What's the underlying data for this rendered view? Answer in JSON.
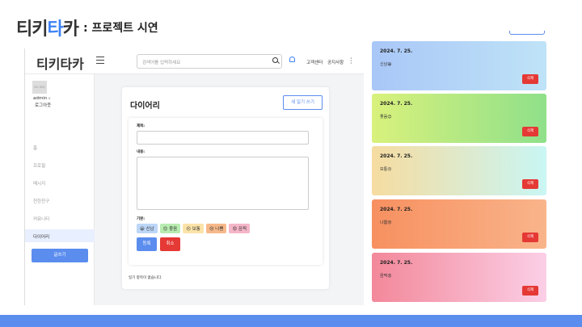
{
  "slide": {
    "logo_chars": [
      "티",
      "키",
      "타",
      "카"
    ],
    "subtitle": ": 프로젝트 시연"
  },
  "header": {
    "logo": "티키타카",
    "search_placeholder": "검색어를 입력하세요",
    "links": [
      "고객센터",
      "공지사항"
    ]
  },
  "sidebar": {
    "avatar_text": "NO IMG",
    "user_name": "admin",
    "logout": "로그아웃",
    "items": [
      "홈",
      "프로필",
      "메시지",
      "친한친구",
      "커뮤니티",
      "다이어리"
    ],
    "active_index": 5,
    "write_label": "글쓰기"
  },
  "diary": {
    "title": "다이어리",
    "new_button": "새 일기 쓰기",
    "title_label": "제목:",
    "content_label": "내용:",
    "mood_label": "기분:",
    "moods": [
      {
        "label": "😀 신남",
        "bg": "#bcd6f7"
      },
      {
        "label": "😊 좋음",
        "bg": "#b8ecb0"
      },
      {
        "label": "😐 보통",
        "bg": "#fbe3a8"
      },
      {
        "label": "😢 나쁨",
        "bg": "#f7b98a"
      },
      {
        "label": "😡 끔찍",
        "bg": "#f5b6c8"
      }
    ],
    "submit": "등록",
    "cancel": "취소",
    "empty": "일기 항목이 없습니다."
  },
  "entries": [
    {
      "date": "2024. 7. 25.",
      "text": "신남😀",
      "delete": "삭제",
      "gradient": "linear-gradient(90deg,#a9c7f7,#bfe3f7)"
    },
    {
      "date": "2024. 7. 25.",
      "text": "좋음😊",
      "delete": "삭제",
      "gradient": "linear-gradient(90deg,#d9f17c,#8fe08a)"
    },
    {
      "date": "2024. 7. 25.",
      "text": "보통😐",
      "delete": "삭제",
      "gradient": "linear-gradient(90deg,#f6dca0,#c9f6f4)"
    },
    {
      "date": "2024. 7. 25.",
      "text": "나쁨😢",
      "delete": "삭제",
      "gradient": "linear-gradient(90deg,#f79060,#f9b48a)"
    },
    {
      "date": "2024. 7. 25.",
      "text": "끔찍😡",
      "delete": "삭제",
      "gradient": "linear-gradient(90deg,#f3889a,#fbcfe6)"
    }
  ],
  "colors": {
    "accent": "#5b8dee",
    "danger": "#e53935"
  }
}
